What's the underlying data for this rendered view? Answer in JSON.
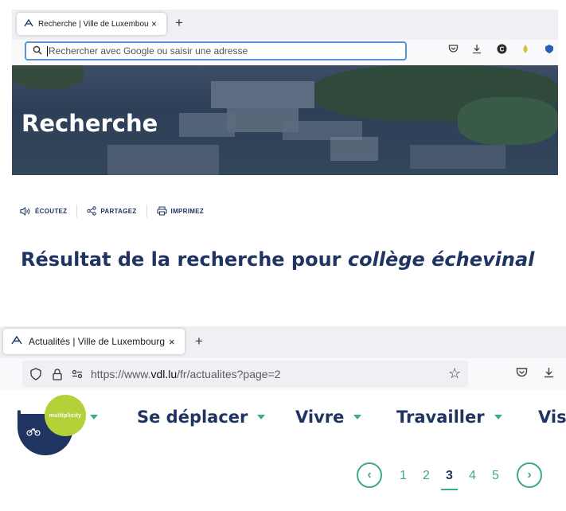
{
  "browser_top": {
    "tab_title": "Recherche | Ville de Luxembourg",
    "new_tab": "+",
    "close": "×",
    "address_placeholder": "Rechercher avec Google ou saisir une adresse"
  },
  "hero": {
    "title": "Recherche"
  },
  "toolbar": {
    "listen_label": "ÉCOUTEZ",
    "share_label": "PARTAGEZ",
    "print_label": "IMPRIMEZ"
  },
  "results": {
    "prefix": "Résultat de la recherche pour ",
    "query": "collège échevinal"
  },
  "browser_bottom": {
    "tab_title": "Actualités | Ville de Luxembourg",
    "new_tab": "+",
    "close": "×",
    "url_prefix": "https://www.",
    "url_host": "vdl.lu",
    "url_path": "/fr/actualites?page=2"
  },
  "site_nav": {
    "items": [
      {
        "label": "L"
      },
      {
        "label": "Se déplacer"
      },
      {
        "label": "Vivre"
      },
      {
        "label": "Travailler"
      },
      {
        "label": "Vis"
      }
    ],
    "badge_text": "multiplicity"
  },
  "pagination": {
    "prev": "‹",
    "next": "›",
    "pages": [
      "1",
      "2",
      "3",
      "4",
      "5"
    ],
    "current": "3"
  },
  "colors": {
    "navy": "#1f3461",
    "green": "#3cae7c",
    "lime": "#b3d23a"
  }
}
